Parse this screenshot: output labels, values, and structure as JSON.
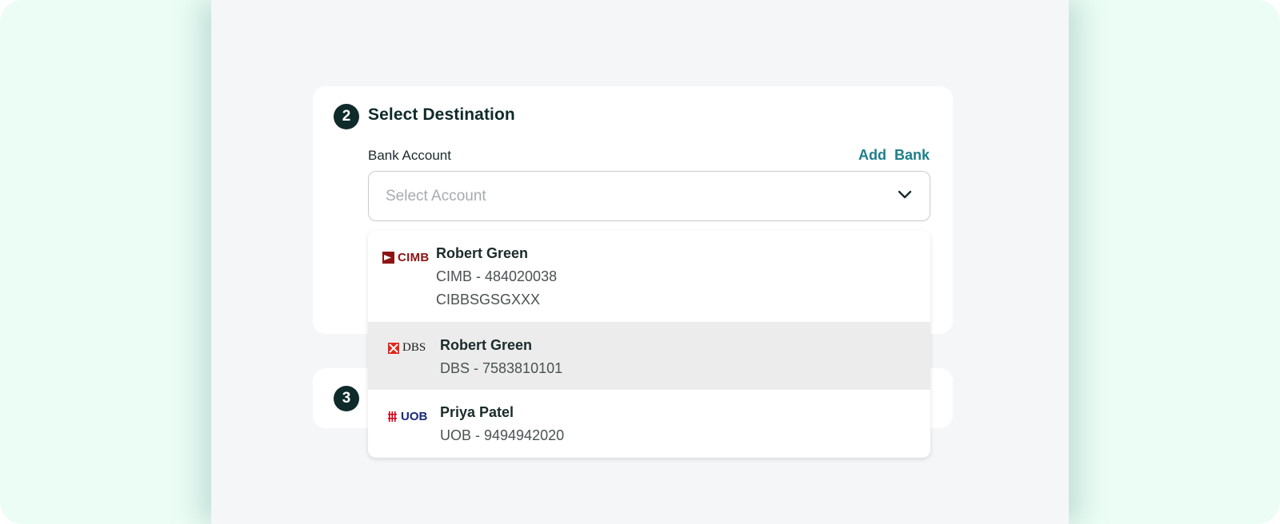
{
  "destination": {
    "step_number": "2",
    "title": "Select Destination",
    "field_label": "Bank Account",
    "add_bank_label": "Add  Bank",
    "select_placeholder": "Select Account"
  },
  "next_step": {
    "step_number": "3"
  },
  "accounts": [
    {
      "logo_text": "CIMB",
      "name": "Robert Green",
      "account": "CIMB - 484020038",
      "swift": "CIBBSGSGXXX",
      "highlighted": false
    },
    {
      "logo_text": "DBS",
      "name": "Robert Green",
      "account": "DBS - 7583810101",
      "highlighted": true
    },
    {
      "logo_text": "UOB",
      "name": "Priya Patel",
      "account": "UOB - 9494942020",
      "highlighted": false
    }
  ],
  "colors": {
    "outer_background": "#ecfdf5",
    "panel_background": "#f5f6f7",
    "badge": "#0f2a2a",
    "link": "#1d7f8a",
    "highlight_row": "#ececec",
    "cimb_red": "#8c1414",
    "dbs_red": "#e1251b",
    "uob_navy": "#1a2a7a",
    "uob_red": "#d0021b"
  },
  "icons": {
    "select_chevron": "chevron-down-icon"
  }
}
